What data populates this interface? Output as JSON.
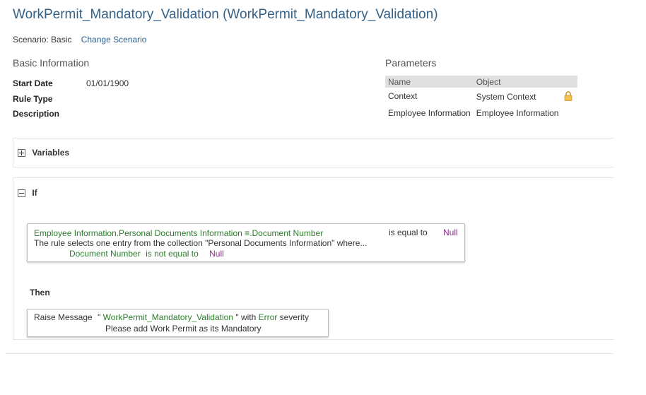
{
  "page": {
    "title": "WorkPermit_Mandatory_Validation (WorkPermit_Mandatory_Validation)"
  },
  "scenario": {
    "label": "Scenario: Basic",
    "change_link": "Change Scenario"
  },
  "basic_info": {
    "heading": "Basic Information",
    "start_date_label": "Start Date",
    "start_date_value": "01/01/1900",
    "rule_type_label": "Rule Type",
    "description_label": "Description"
  },
  "parameters": {
    "heading": "Parameters",
    "col_name": "Name",
    "col_object": "Object",
    "rows": [
      {
        "name": "Context",
        "object": "System Context"
      },
      {
        "name": "Employee Information",
        "object": "Employee Information"
      }
    ]
  },
  "variables": {
    "label": "Variables"
  },
  "if_section": {
    "label": "If",
    "condition_left": "Employee Information.Personal Documents Information",
    "condition_icon": "≡",
    "condition_field": ".Document Number",
    "operator": "is equal to",
    "value": "Null",
    "description": "The rule selects one entry from the collection \"Personal Documents Information\" where...",
    "sub_field": "Document Number",
    "sub_operator": "is not equal to",
    "sub_value": "Null"
  },
  "then_section": {
    "label": "Then",
    "action": "Raise Message",
    "message_open": "\"",
    "message_id": "WorkPermit_Mandatory_Validation",
    "message_close": "\"",
    "with_text": "with",
    "severity": "Error",
    "severity_suffix": "severity",
    "message_text": "Please add Work Permit as its Mandatory"
  },
  "colors": {
    "title": "#346187",
    "green": "#2b7d2b",
    "purple": "#8a2e8a",
    "lock": "#e0a628"
  }
}
